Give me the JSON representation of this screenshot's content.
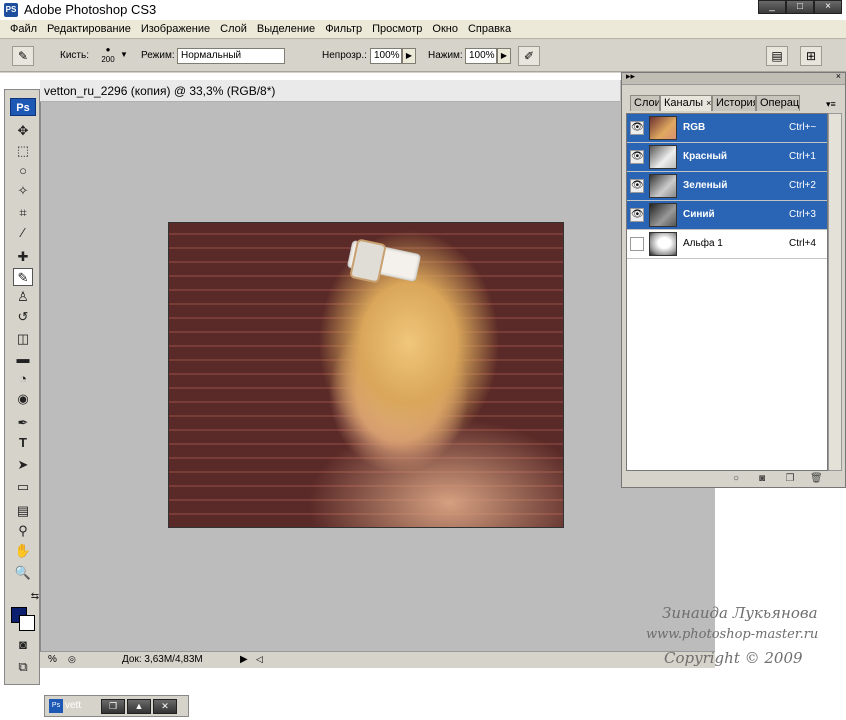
{
  "app": {
    "logo": "PS",
    "title": "Adobe Photoshop CS3"
  },
  "window_buttons": [
    "_",
    "□",
    "×"
  ],
  "menu": [
    "Файл",
    "Редактирование",
    "Изображение",
    "Слой",
    "Выделение",
    "Фильтр",
    "Просмотр",
    "Окно",
    "Справка"
  ],
  "options": {
    "brush_label": "Кисть:",
    "brush_size": "200",
    "mode_label": "Режим:",
    "mode_value": "Нормальный",
    "opacity_label": "Непрозр.:",
    "opacity_value": "100%",
    "flow_label": "Нажим:",
    "flow_value": "100%"
  },
  "document": {
    "title": "vetton_ru_2296 (копия) @ 33,3% (RGB/8*)",
    "zoom_status": "%",
    "doc_info": "Док: 3,63M/4,83M"
  },
  "toolbox": {
    "badge": "Ps"
  },
  "panel": {
    "tabs": [
      "Слои",
      "Каналы",
      "История",
      "Операции"
    ],
    "channels": [
      {
        "name": "RGB",
        "shortcut": "Ctrl+~",
        "selected": true,
        "visible": true
      },
      {
        "name": "Красный",
        "shortcut": "Ctrl+1",
        "selected": true,
        "visible": true
      },
      {
        "name": "Зеленый",
        "shortcut": "Ctrl+2",
        "selected": true,
        "visible": true
      },
      {
        "name": "Синий",
        "shortcut": "Ctrl+3",
        "selected": true,
        "visible": true
      },
      {
        "name": "Альфа 1",
        "shortcut": "Ctrl+4",
        "selected": false,
        "visible": false
      }
    ]
  },
  "watermark": {
    "author": "Зинаида Лукьянова",
    "site": "www.photoshop-master.ru",
    "copyright": "Copyright © 2009"
  },
  "minimized_doc": {
    "label": "vett"
  },
  "colors": {
    "selection": "#2a64b4",
    "foreground": "#0b1f6e",
    "background": "#ffffff"
  }
}
